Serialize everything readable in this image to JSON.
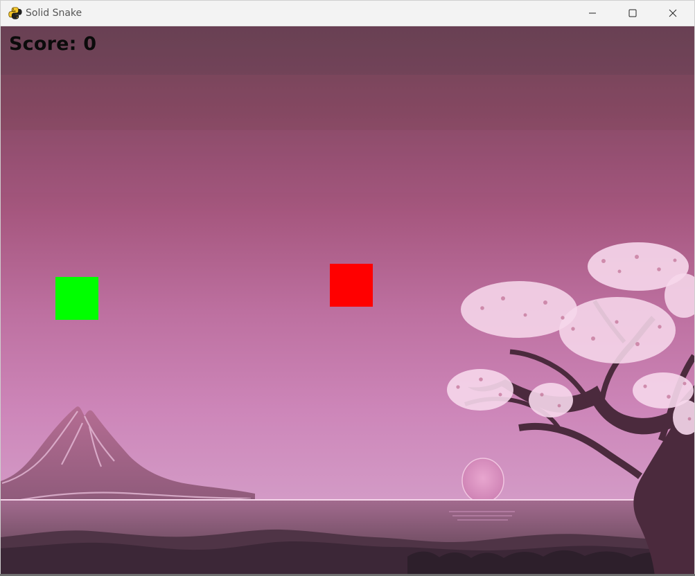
{
  "window": {
    "title": "Solid Snake",
    "icon": "python-icon",
    "controls": {
      "minimize_icon": "minimize-icon",
      "maximize_icon": "maximize-icon",
      "close_icon": "close-icon"
    }
  },
  "game": {
    "score_text": "Score: 0",
    "snake_color": "#00ff00",
    "food_color": "#ff0000",
    "background": "pink sunset landscape with mountain, sun and cherry blossom tree"
  },
  "colors": {
    "titlebar": "#f3f3f3",
    "sky_top": "#684052",
    "sky_bottom": "#d39ac6",
    "score": "#0b0b0b"
  }
}
